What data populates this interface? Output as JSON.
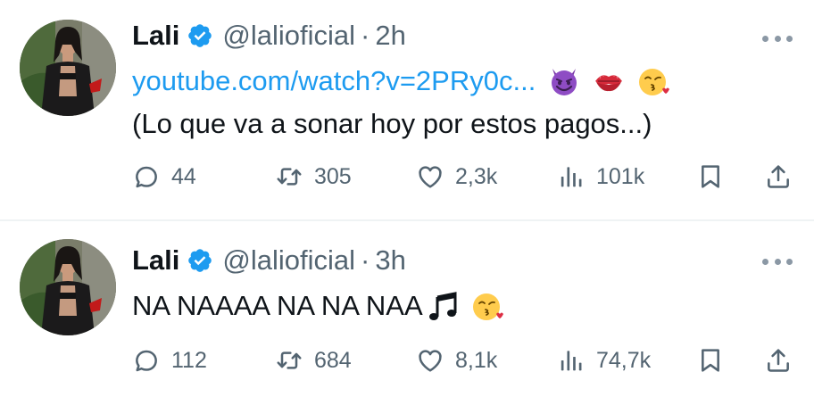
{
  "tweets": [
    {
      "name": "Lali",
      "handle": "@lalioficial",
      "separator": "·",
      "time": "2h",
      "link": "youtube.com/watch?v=2PRy0c...",
      "emojis": [
        "smiling-devil-emoji",
        "kiss-mark-emoji",
        "face-blowing-kiss-emoji"
      ],
      "text": "(Lo que va a sonar hoy por estos pagos...)",
      "replies": "44",
      "reposts": "305",
      "likes": "2,3k",
      "views": "101k"
    },
    {
      "name": "Lali",
      "handle": "@lalioficial",
      "separator": "·",
      "time": "3h",
      "text": "NA NAAAA NA NA NAA",
      "emojis": [
        "musical-notes-emoji",
        "face-blowing-kiss-emoji"
      ],
      "replies": "112",
      "reposts": "684",
      "likes": "8,1k",
      "views": "74,7k"
    }
  ],
  "colors": {
    "text": "#0f1419",
    "secondary": "#536471",
    "link": "#1d9bf0",
    "verified": "#1d9bf0",
    "divider": "#eff3f4"
  }
}
